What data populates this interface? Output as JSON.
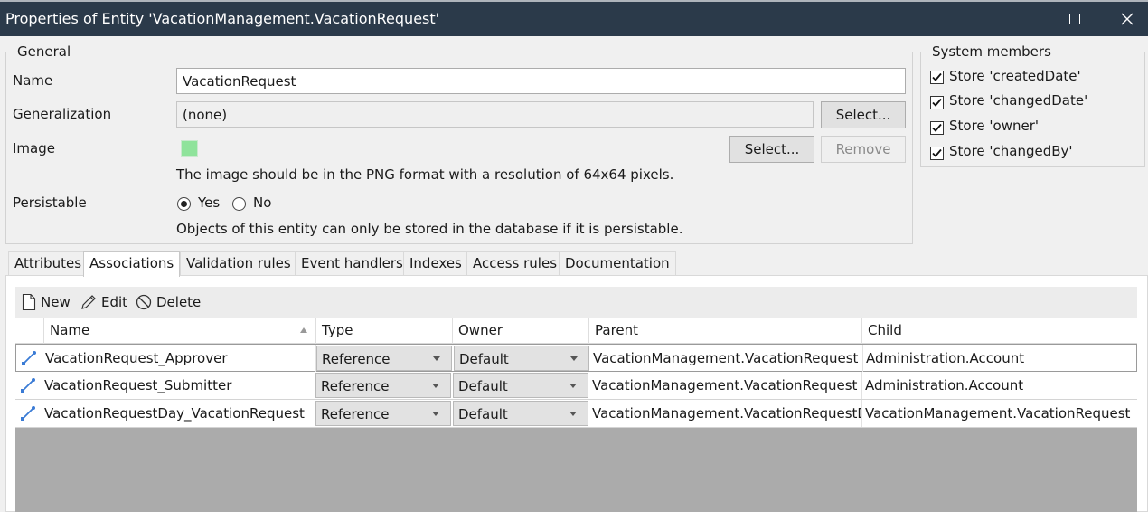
{
  "window": {
    "title": "Properties of Entity 'VacationManagement.VacationRequest'"
  },
  "general": {
    "legend": "General",
    "name_label": "Name",
    "name_value": "VacationRequest",
    "generalization_label": "Generalization",
    "generalization_value": "(none)",
    "generalization_select": "Select...",
    "image_label": "Image",
    "image_select": "Select...",
    "image_remove": "Remove",
    "image_hint": "The image should be in the PNG format with a resolution of 64x64 pixels.",
    "persistable_label": "Persistable",
    "persistable_yes": "Yes",
    "persistable_no": "No",
    "persistable_selected": "Yes",
    "persistable_hint": "Objects of this entity can only be stored in the database if it is persistable.",
    "image_color": "#8fe39b"
  },
  "system_members": {
    "legend": "System members",
    "items": [
      {
        "label": "Store 'createdDate'",
        "checked": true
      },
      {
        "label": "Store 'changedDate'",
        "checked": true
      },
      {
        "label": "Store 'owner'",
        "checked": true
      },
      {
        "label": "Store 'changedBy'",
        "checked": true
      }
    ]
  },
  "tabs": [
    {
      "label": "Attributes"
    },
    {
      "label": "Associations",
      "active": true
    },
    {
      "label": "Validation rules"
    },
    {
      "label": "Event handlers"
    },
    {
      "label": "Indexes"
    },
    {
      "label": "Access rules"
    },
    {
      "label": "Documentation"
    }
  ],
  "toolbar": {
    "new_label": "New",
    "edit_label": "Edit",
    "delete_label": "Delete"
  },
  "associations": {
    "columns": [
      "Name",
      "Type",
      "Owner",
      "Parent",
      "Child"
    ],
    "sort_column": "Name",
    "rows": [
      {
        "name": "VacationRequest_Approver",
        "type": "Reference",
        "owner": "Default",
        "parent": "VacationManagement.VacationRequest",
        "child": "Administration.Account"
      },
      {
        "name": "VacationRequest_Submitter",
        "type": "Reference",
        "owner": "Default",
        "parent": "VacationManagement.VacationRequest",
        "child": "Administration.Account"
      },
      {
        "name": "VacationRequestDay_VacationRequest",
        "type": "Reference",
        "owner": "Default",
        "parent": "VacationManagement.VacationRequestDay",
        "child": "VacationManagement.VacationRequest"
      }
    ]
  },
  "colors": {
    "titlebar": "#2b3a4a",
    "accent_icon": "#3a7bd5",
    "grid_empty": "#ababab"
  }
}
